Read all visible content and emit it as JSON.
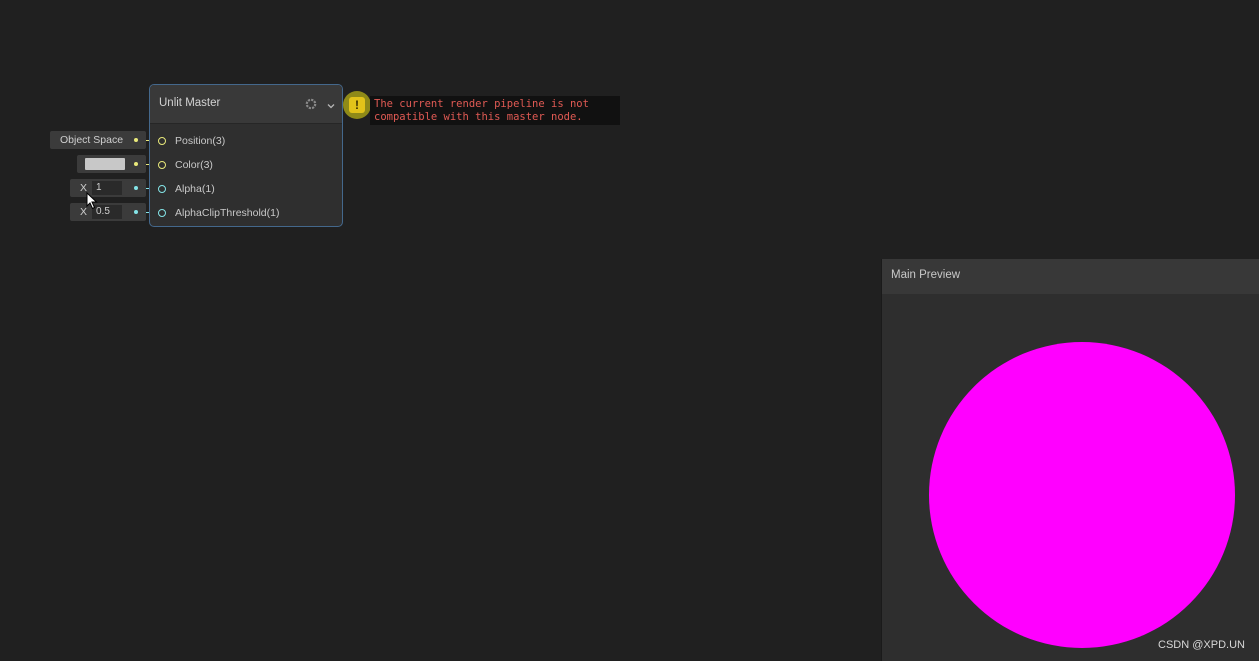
{
  "node": {
    "title": "Unlit Master",
    "ports": [
      {
        "label": "Position(3)",
        "color": "#e8e87a"
      },
      {
        "label": "Color(3)",
        "color": "#e8e87a"
      },
      {
        "label": "Alpha(1)",
        "color": "#84e4e7"
      },
      {
        "label": "AlphaClipThreshold(1)",
        "color": "#84e4e7"
      }
    ],
    "icons": [
      "gear-icon",
      "chevron-down-icon"
    ]
  },
  "inputs": {
    "position_space": "Object Space",
    "color_swatch": "#c8c8c8",
    "alpha": {
      "axis": "X",
      "value": "1"
    },
    "alpha_clip": {
      "axis": "X",
      "value": "0.5"
    }
  },
  "warning": {
    "icon": "warning-icon",
    "glyph": "!",
    "message": "The current render pipeline is not\ncompatible with this master node."
  },
  "preview": {
    "title": "Main Preview",
    "sphere_color": "#ff00ff"
  },
  "watermark": "CSDN @XPD.UN"
}
